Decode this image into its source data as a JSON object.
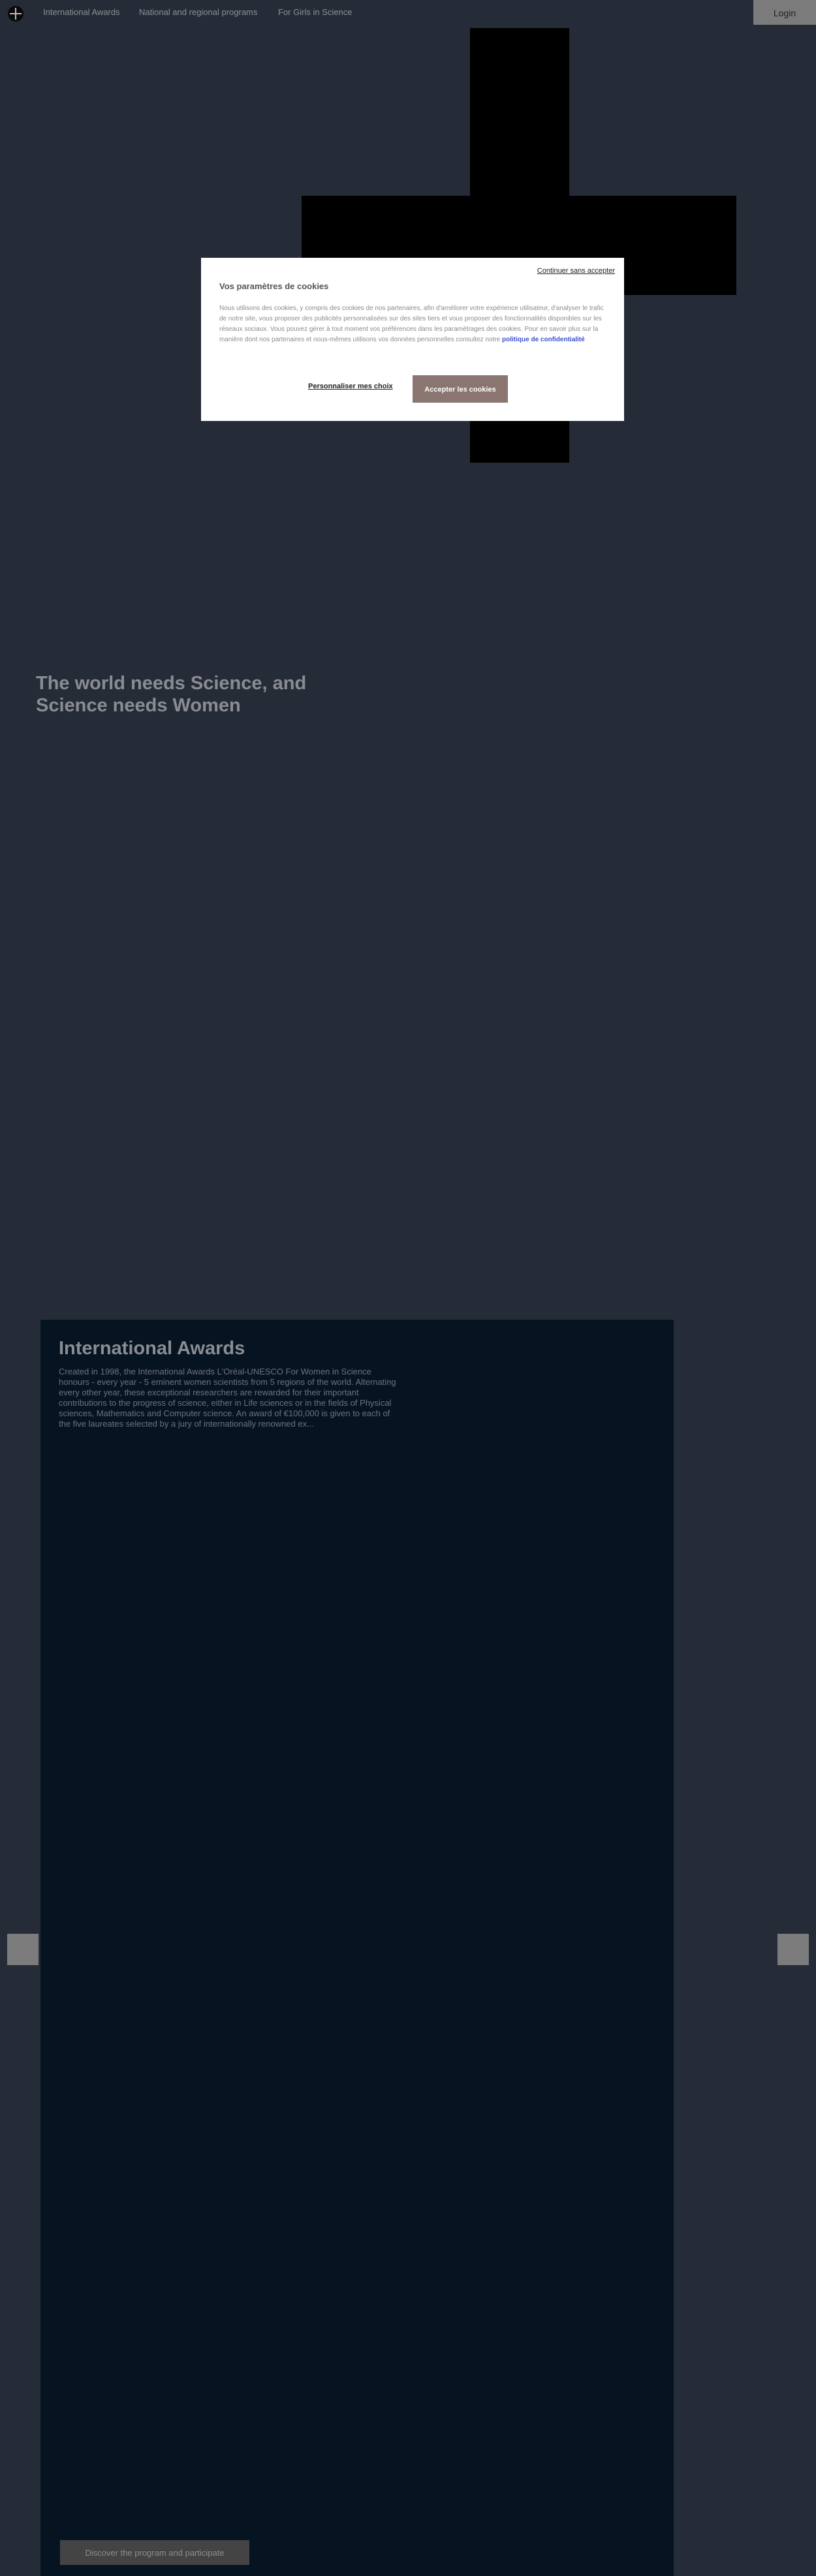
{
  "nav": {
    "logo_icon": "lotus-cross-logo-icon",
    "items": [
      "International Awards",
      "National and regional programs",
      "For Girls in Science"
    ],
    "login_label": "Login"
  },
  "cookie_modal": {
    "continue_label": "Continuer sans accepter",
    "title": "Vos paramètres de cookies",
    "body": "Nous utilisons des cookies, y compris des cookies de nos partenaires, afin d'améliorer votre expérience utilisateur, d'analyser le trafic de notre site, vous proposer des publicités personnalisées sur des sites tiers et vous proposer des fonctionnalités disponibles sur les réseaux sociaux. Vous pouvez gérer à tout moment vos préférences dans les paramétrages des cookies. Pour en savoir plus sur la manière dont nos partenaires et nous-mêmes utilisons vos données personnelles consultez notre",
    "policy_link": "politique de confidentialité",
    "customize_label": "Personnaliser mes choix",
    "accept_label": "Accepter les cookies"
  },
  "hero": {
    "title": "The world needs Science, and Science needs Women"
  },
  "awards": {
    "title": "International Awards",
    "description": "Created in 1998, the International Awards L'Oréal-UNESCO For Women in Science honours - every year - 5 eminent women scientists from 5 regions of the world. Alternating every other year, these exceptional researchers are rewarded for their important contributions to the progress of science, either in Life sciences or in the fields of Physical sciences, Mathematics and Computer science. An award of €100,000 is given to each of the five laureates selected by a jury of internationally renowned ex...",
    "cta_label": "Discover the program and participate"
  },
  "carousel": {
    "prev_icon": "arrow-left-icon",
    "next_icon": "arrow-right-icon"
  },
  "colors": {
    "background": "#262c37",
    "panel": "#061422",
    "accept_button": "#8a7570",
    "link": "#3a4fd0"
  }
}
